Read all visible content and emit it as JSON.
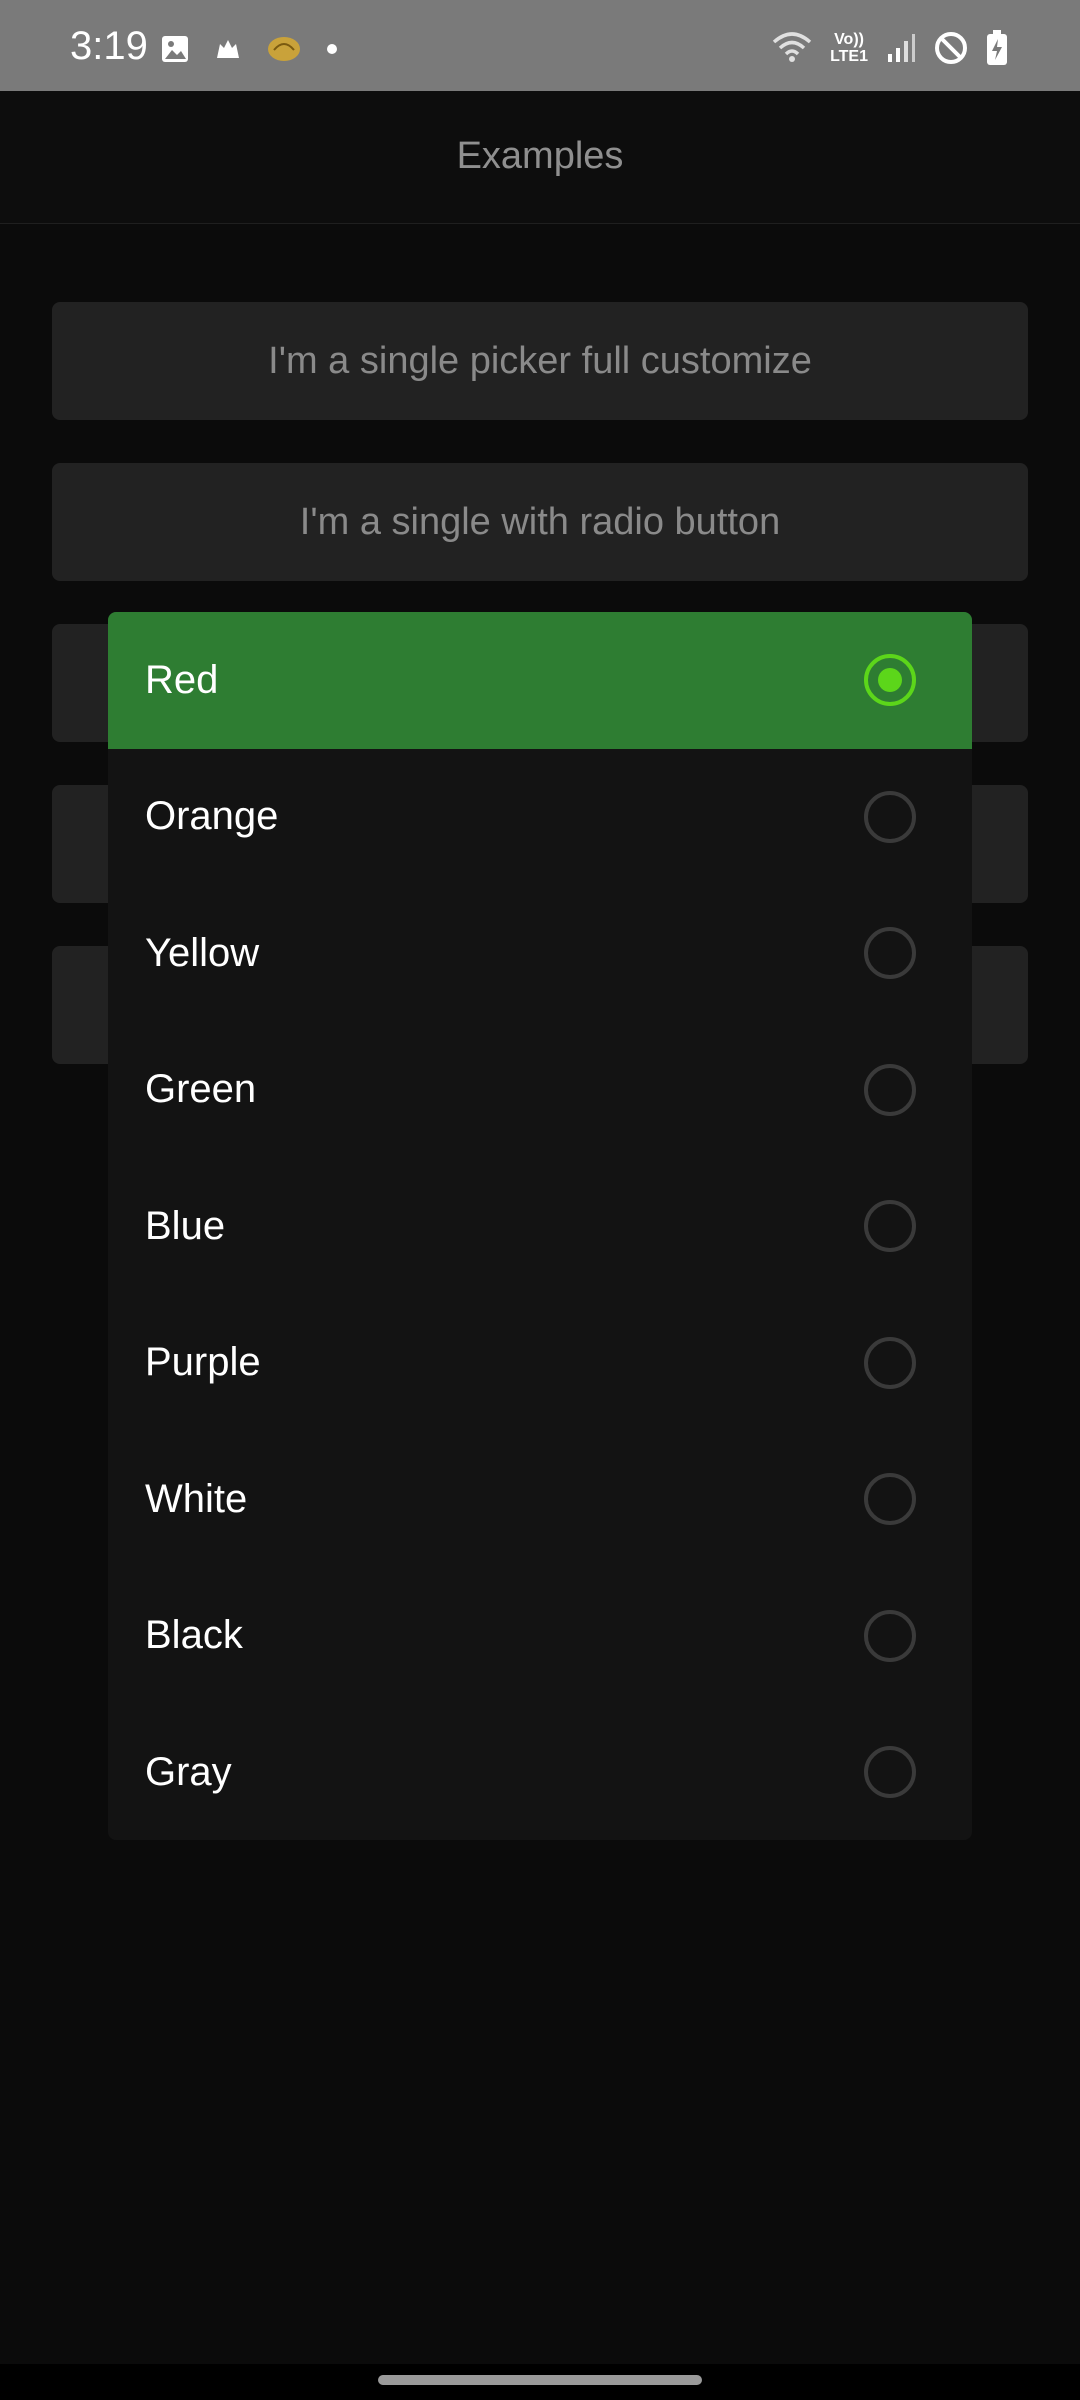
{
  "status_bar": {
    "time": "3:19",
    "network_text": "Vo))\nLTE1",
    "icons": [
      "gallery-icon",
      "notification-icon",
      "app-notification-icon",
      "dot-icon",
      "wifi-icon",
      "signal-icon",
      "do-not-disturb-icon",
      "battery-charging-icon"
    ]
  },
  "app_bar": {
    "title": "Examples"
  },
  "buttons": [
    {
      "label": "I'm a single picker full customize"
    },
    {
      "label": "I'm a single with radio button"
    }
  ],
  "picker": {
    "items": [
      {
        "label": "Red",
        "selected": true
      },
      {
        "label": "Orange",
        "selected": false
      },
      {
        "label": "Yellow",
        "selected": false
      },
      {
        "label": "Green",
        "selected": false
      },
      {
        "label": "Blue",
        "selected": false
      },
      {
        "label": "Purple",
        "selected": false
      },
      {
        "label": "White",
        "selected": false
      },
      {
        "label": "Black",
        "selected": false
      },
      {
        "label": "Gray",
        "selected": false
      }
    ]
  },
  "colors": {
    "accent": "#2e7d32",
    "radio_active": "#5cd61a",
    "background": "#0b0b0b"
  }
}
